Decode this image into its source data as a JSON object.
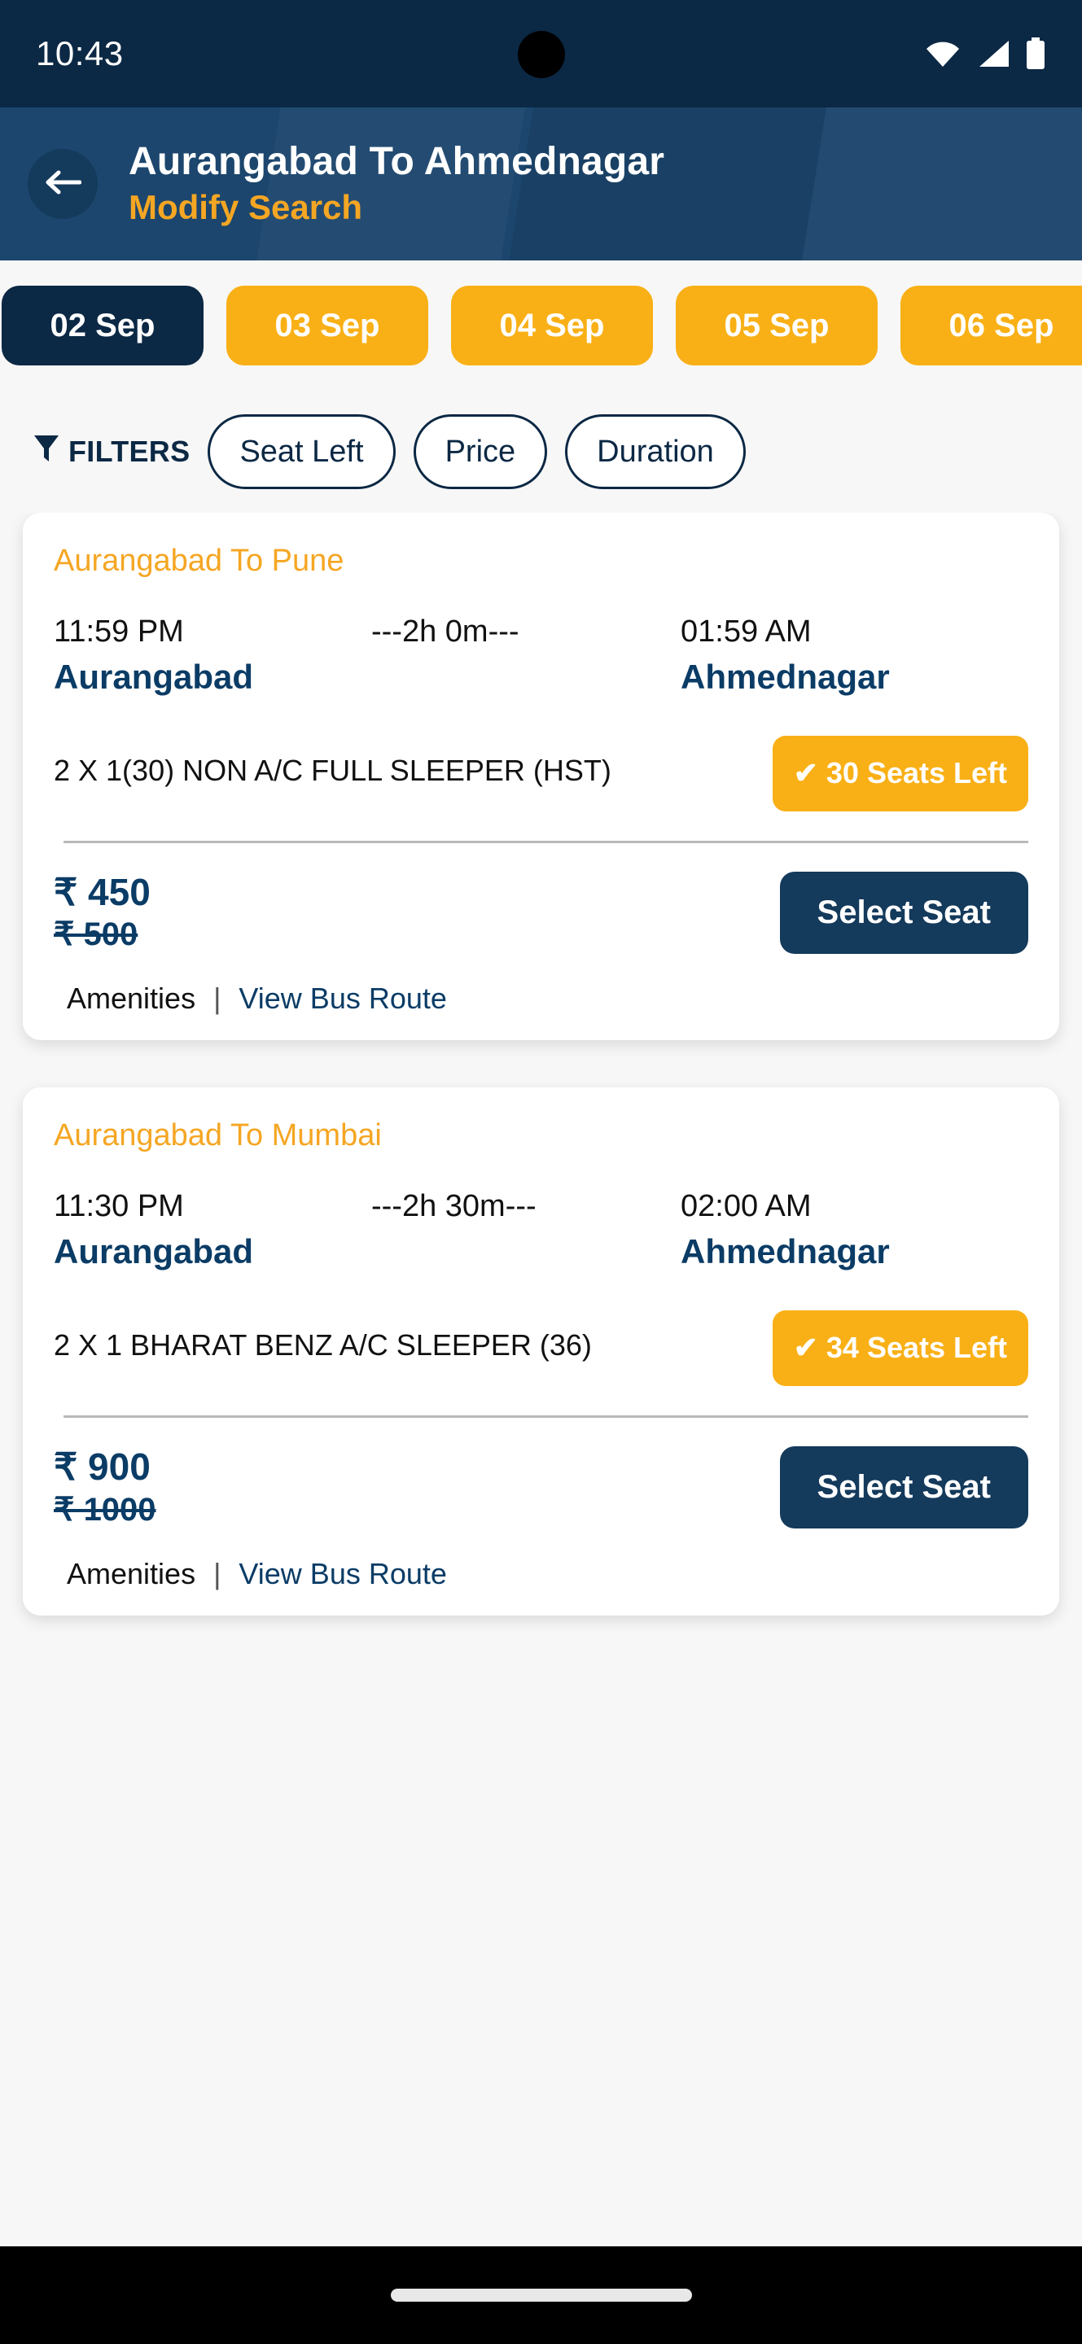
{
  "status_bar": {
    "time": "10:43",
    "wifi_icon": "wifi-icon",
    "signal_icon": "signal-icon",
    "battery_icon": "battery-icon"
  },
  "header": {
    "back_icon": "back-arrow-icon",
    "title": "Aurangabad To Ahmednagar",
    "modify_search": "Modify Search"
  },
  "date_strip": {
    "dates": [
      {
        "label": "02 Sep",
        "selected": true
      },
      {
        "label": "03 Sep",
        "selected": false
      },
      {
        "label": "04 Sep",
        "selected": false
      },
      {
        "label": "05 Sep",
        "selected": false
      },
      {
        "label": "06 Sep",
        "selected": false
      }
    ]
  },
  "filters": {
    "icon": "funnel-icon",
    "label": "FILTERS",
    "chips": [
      "Seat Left",
      "Price",
      "Duration"
    ]
  },
  "buses": [
    {
      "route_title": "Aurangabad To Pune",
      "departure_time": "11:59 PM",
      "duration": "---2h 0m---",
      "arrival_time": "01:59 AM",
      "from_city": "Aurangabad",
      "to_city": "Ahmednagar",
      "bus_type": "2 X 1(30) NON A/C FULL SLEEPER (HST)",
      "seats_badge": "✔ 30 Seats Left",
      "price_now": "₹ 450",
      "price_was": "₹ 500",
      "select_label": "Select Seat",
      "amenities_label": "Amenities",
      "separator": "|",
      "route_link": "View Bus Route"
    },
    {
      "route_title": "Aurangabad To Mumbai",
      "departure_time": "11:30 PM",
      "duration": "---2h 30m---",
      "arrival_time": "02:00 AM",
      "from_city": "Aurangabad",
      "to_city": "Ahmednagar",
      "bus_type": "2 X 1 BHARAT BENZ A/C SLEEPER (36)",
      "seats_badge": "✔ 34 Seats Left",
      "price_now": "₹ 900",
      "price_was": "₹ 1000",
      "select_label": "Select Seat",
      "amenities_label": "Amenities",
      "separator": "|",
      "route_link": "View Bus Route"
    }
  ],
  "colors": {
    "navy_dark": "#0b2844",
    "navy_header": "#1c466d",
    "navy_button": "#143a5c",
    "navy_text": "#0b3c66",
    "amber": "#f9b016",
    "amber_text": "#f5a623",
    "page_bg": "#f7f7f7"
  }
}
